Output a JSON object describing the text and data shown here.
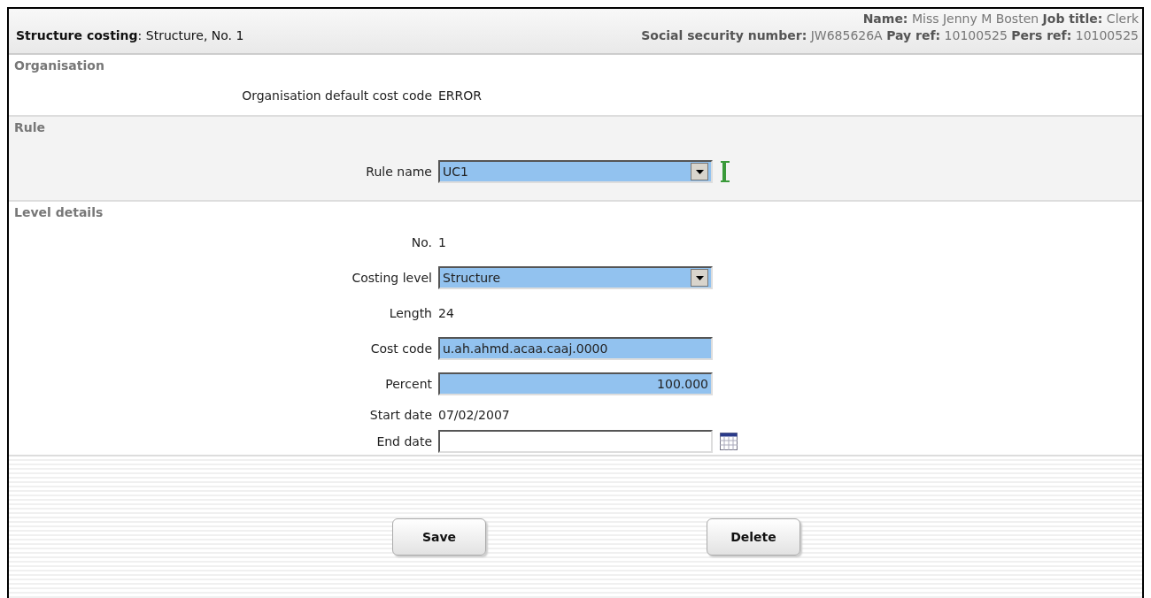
{
  "header": {
    "title": "**Structure costing**: Structure, No. 1",
    "employee_lines": [
      "**Name:** Miss Jenny M Bosten **Job title:** Clerk",
      "**Social security number:** JW685626A **Pay ref:** 10100525 **Pers ref:** 10100525"
    ]
  },
  "sections": [
    {
      "title": "Organisation",
      "shaded": false,
      "rows": [
        {
          "kind": "text",
          "label": "Organisation default cost code",
          "value": "ERROR"
        }
      ]
    },
    {
      "title": "Rule",
      "shaded": true,
      "rows": [
        {
          "kind": "select",
          "label": "Rule name",
          "value": "UC1",
          "highlighted": true,
          "required": true
        }
      ]
    },
    {
      "title": "Level details",
      "shaded": false,
      "rows": [
        {
          "kind": "text",
          "label": "No.",
          "value": "1"
        },
        {
          "kind": "select",
          "label": "Costing level",
          "value": "Structure",
          "highlighted": true
        },
        {
          "kind": "text",
          "label": "Length",
          "value": "24"
        },
        {
          "kind": "input",
          "label": "Cost code",
          "value": "u.ah.ahmd.acaa.caaj.0000",
          "highlighted": true
        },
        {
          "kind": "number",
          "label": "Percent",
          "value": "100.000",
          "highlighted": true
        },
        {
          "kind": "text",
          "label": "Start date",
          "value": "07/02/2007"
        },
        {
          "kind": "date",
          "label": "End date",
          "highlighted": false
        }
      ]
    }
  ],
  "buttons": [
    "Save",
    "Delete"
  ]
}
